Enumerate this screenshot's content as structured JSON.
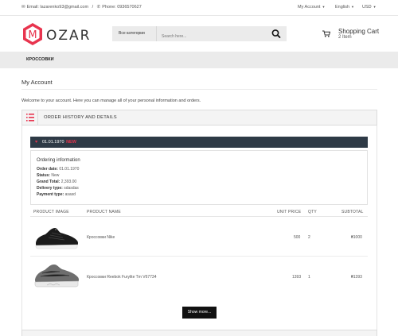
{
  "topbar": {
    "email": "Email: lazarenko93@gmail.com",
    "separator": "/",
    "phone": "Phone: 0936570627",
    "my_account": "My Account",
    "language": "English",
    "currency": "USD"
  },
  "logo": {
    "text": "OZAR",
    "letter": "M",
    "accent_color": "#e8344e"
  },
  "search": {
    "category": "Все категории",
    "placeholder": "Search here..."
  },
  "cart": {
    "title": "Shopping Cart",
    "count": "2 Item"
  },
  "nav": {
    "item": "КРОССОВКИ"
  },
  "page": {
    "title": "My Account",
    "welcome": "Welcome to your account. Here you can manage all of your personal information and orders."
  },
  "panel": {
    "title": "ORDER HISTORY AND DETAILS"
  },
  "order": {
    "date": "01.01.1970",
    "badge": "NEW",
    "info_title": "Ordering information",
    "rows": [
      {
        "label": "Order date:",
        "value": "01.01.1970"
      },
      {
        "label": "Status:",
        "value": "New"
      },
      {
        "label": "Grand Total:",
        "value": "2,393.00"
      },
      {
        "label": "Delivery type:",
        "value": "sdasdas"
      },
      {
        "label": "Payment type:",
        "value": "asasd"
      }
    ]
  },
  "table": {
    "headers": {
      "image": "PRODUCT IMAGE",
      "name": "PRODUCT NAME",
      "price": "UNIT PRICE",
      "qty": "QTY",
      "subtotal": "SUBTOTAL"
    },
    "rows": [
      {
        "name": "Кроссовки Nike",
        "price": "500",
        "qty": "2",
        "subtotal": "₴1000"
      },
      {
        "name": "Кроссовки Reebok Furylite Tm V67734",
        "price": "1393",
        "qty": "1",
        "subtotal": "₴1393"
      }
    ]
  },
  "show_more": "Show more...",
  "colors": {
    "dark_bar": "#2e3a46",
    "accent": "#e8344e",
    "nav_bg": "#ebebeb"
  }
}
